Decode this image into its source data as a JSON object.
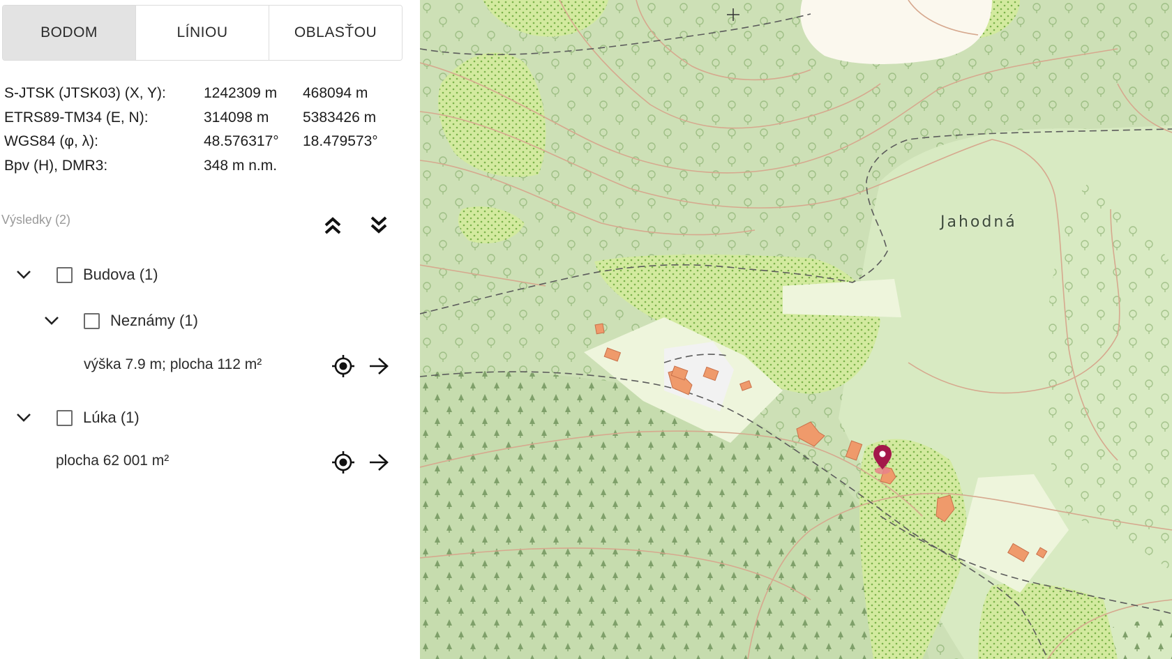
{
  "tabs": [
    {
      "label": "BODOM",
      "active": true
    },
    {
      "label": "LÍNIOU",
      "active": false
    },
    {
      "label": "OBLASŤOU",
      "active": false
    }
  ],
  "coords": [
    {
      "label": "S-JTSK (JTSK03) (X, Y):",
      "v1": "1242309 m",
      "v2": "468094 m"
    },
    {
      "label": "ETRS89-TM34 (E, N):",
      "v1": "314098 m",
      "v2": "5383426 m"
    },
    {
      "label": "WGS84 (φ, λ):",
      "v1": "48.576317°",
      "v2": "18.479573°"
    },
    {
      "label": "Bpv (H), DMR3:",
      "v1": "348 m n.m.",
      "v2": ""
    }
  ],
  "results": {
    "header": "Výsledky (2)",
    "collapse_all_icon": "double-chevron-up-icon",
    "expand_all_icon": "double-chevron-down-icon",
    "groups": [
      {
        "label": "Budova (1)",
        "subgroup": {
          "label": "Neznámy (1)",
          "detail": "výška 7.9 m; plocha 112 m²"
        }
      },
      {
        "label": "Lúka (1)",
        "detail": "plocha 62 001 m²"
      }
    ]
  },
  "map": {
    "place_label": "Jahodná",
    "marker_color": "#a3174a",
    "forest_color": "#cfe2b8",
    "meadow_color": "#dcebc8",
    "building_color": "#ef9a6b",
    "contour_color": "#d9a98c"
  }
}
